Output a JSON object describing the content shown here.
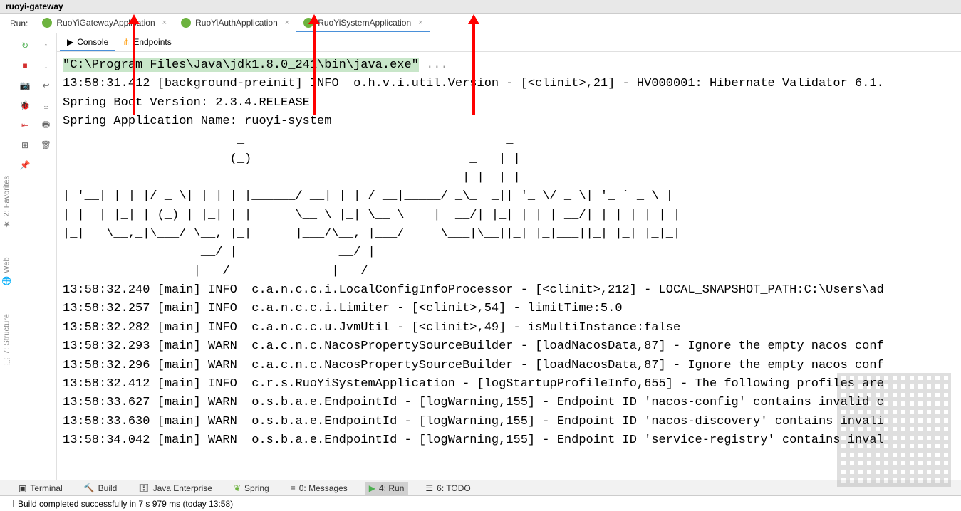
{
  "project_name": "ruoyi-gateway",
  "run_label": "Run:",
  "tabs": [
    {
      "label": "RuoYiGatewayApplication"
    },
    {
      "label": "RuoYiAuthApplication"
    },
    {
      "label": "RuoYiSystemApplication"
    }
  ],
  "active_tab_index": 2,
  "console_tabs": {
    "console": "Console",
    "endpoints": "Endpoints"
  },
  "toolbar1": {
    "rerun": "rerun",
    "stop": "stop",
    "camera": "camera",
    "bug": "debug",
    "exit": "exit",
    "layout": "layout",
    "pin": "pin"
  },
  "toolbar2": {
    "up": "up",
    "down": "down",
    "wrap": "wrap",
    "scroll": "scroll-to-end",
    "print": "print",
    "trash": "delete"
  },
  "console_lines": {
    "cmd": "\"C:\\Program Files\\Java\\jdk1.8.0_241\\bin\\java.exe\"",
    "dots": " ...",
    "l1": "13:58:31.412 [background-preinit] INFO  o.h.v.i.util.Version - [<clinit>,21] - HV000001: Hibernate Validator 6.1.",
    "l2": "Spring Boot Version: 2.3.4.RELEASE",
    "l3": "Spring Application Name: ruoyi-system",
    "a1": "                        _                                    _",
    "a2": "                       (_)                              _   | |",
    "a3": " _ __ _   _  ___  _   _ _ ______ ___ _   _ ___ _____ __| |_ | |__  ___  _ __ ___ _",
    "a4": "| '__| | | |/ _ \\| | | | |______/ __| | | / __|_____/ _\\_  _|| '_ \\/ _ \\| '_ ` _ \\ |",
    "a5": "| |  | |_| | (_) | |_| | |      \\__ \\ |_| \\__ \\    |  __/| |_| | | | __/| | | | | | |",
    "a6": "|_|   \\__,_|\\___/ \\__, |_|      |___/\\__, |___/     \\___|\\__||_| |_|___||_| |_| |_|_|",
    "a7": "                   __/ |              __/ |",
    "a8": "                  |___/              |___/",
    "l4": "13:58:32.240 [main] INFO  c.a.n.c.c.i.LocalConfigInfoProcessor - [<clinit>,212] - LOCAL_SNAPSHOT_PATH:C:\\Users\\ad",
    "l5": "13:58:32.257 [main] INFO  c.a.n.c.c.i.Limiter - [<clinit>,54] - limitTime:5.0",
    "l6": "13:58:32.282 [main] INFO  c.a.n.c.c.u.JvmUtil - [<clinit>,49] - isMultiInstance:false",
    "l7": "13:58:32.293 [main] WARN  c.a.c.n.c.NacosPropertySourceBuilder - [loadNacosData,87] - Ignore the empty nacos conf",
    "l8": "13:58:32.296 [main] WARN  c.a.c.n.c.NacosPropertySourceBuilder - [loadNacosData,87] - Ignore the empty nacos conf",
    "l9": "13:58:32.412 [main] INFO  c.r.s.RuoYiSystemApplication - [logStartupProfileInfo,655] - The following profiles are",
    "l10": "13:58:33.627 [main] WARN  o.s.b.a.e.EndpointId - [logWarning,155] - Endpoint ID 'nacos-config' contains invalid c",
    "l11": "13:58:33.630 [main] WARN  o.s.b.a.e.EndpointId - [logWarning,155] - Endpoint ID 'nacos-discovery' contains invali",
    "l12": "13:58:34.042 [main] WARN  o.s.b.a.e.EndpointId - [logWarning,155] - Endpoint ID 'service-registry' contains inval"
  },
  "left_sidebar": {
    "favorites": "2: Favorites",
    "web": "Web",
    "structure": "7: Structure"
  },
  "bottom": {
    "terminal": "Terminal",
    "build": "Build",
    "java_enterprise": "Java Enterprise",
    "spring": "Spring",
    "messages_prefix": "0",
    "messages_suffix": ": Messages",
    "run_prefix": "4",
    "run_suffix": ": Run",
    "todo_prefix": "6",
    "todo_suffix": ": TODO"
  },
  "status": "Build completed successfully in 7 s 979 ms (today 13:58)"
}
